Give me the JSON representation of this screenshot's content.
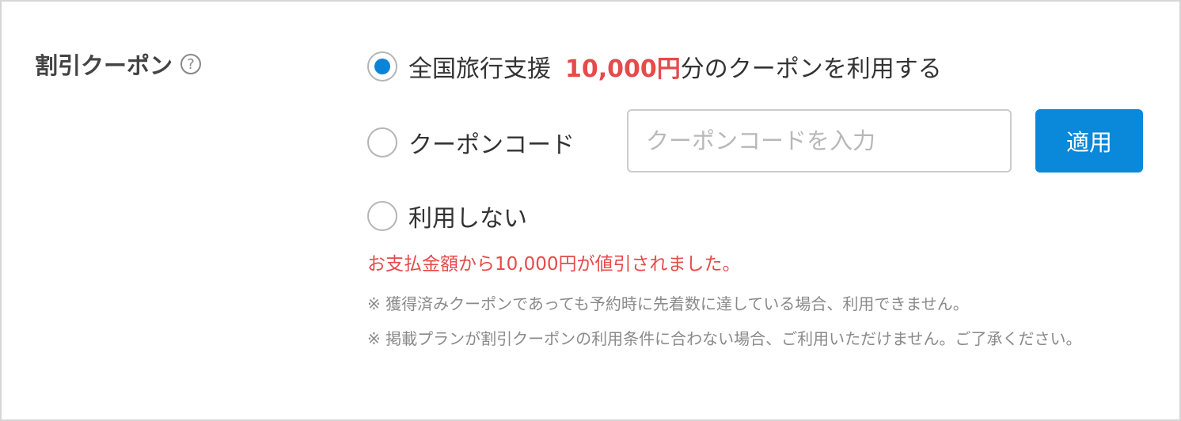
{
  "coupon_section": {
    "label": "割引クーポン",
    "help_icon": "question-circle-icon",
    "help_symbol": "?"
  },
  "options": {
    "travel_support": {
      "label": "全国旅行支援",
      "amount": "10,000円",
      "suffix": "分のクーポンを利用する",
      "selected": true
    },
    "coupon_code": {
      "label": "クーポンコード",
      "input_placeholder": "クーポンコードを入力",
      "input_value": "",
      "apply_label": "適用",
      "selected": false
    },
    "no_use": {
      "label": "利用しない",
      "selected": false
    }
  },
  "messages": {
    "discount": "お支払金額から10,000円が値引されました。",
    "note1": "※ 獲得済みクーポンであっても予約時に先着数に達している場合、利用できません。",
    "note2": "※ 掲載プランが割引クーポンの利用条件に合わない場合、ご利用いただけません。ご了承ください。"
  },
  "colors": {
    "accent": "#0a88d9",
    "highlight": "#e64a4a",
    "muted": "#8a8a8a"
  }
}
